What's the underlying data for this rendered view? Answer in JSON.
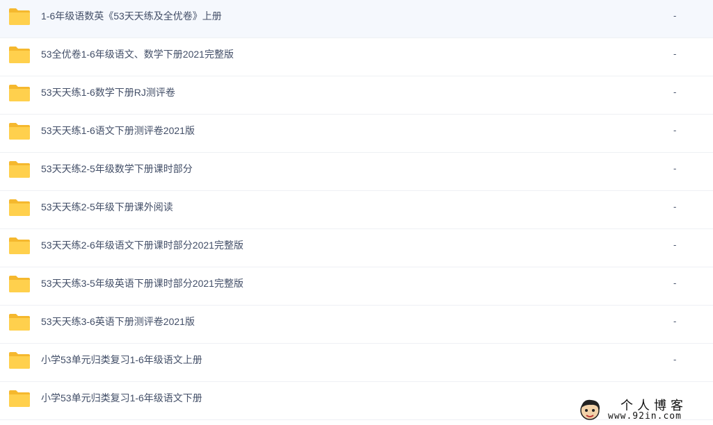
{
  "colors": {
    "folder": "#ffd04d",
    "folder_back": "#f5b82e",
    "text": "#424e67",
    "divider": "#eef0f4"
  },
  "files": [
    {
      "icon": "folder-icon",
      "name": "1-6年级语数英《53天天练及全优卷》上册",
      "size": "-"
    },
    {
      "icon": "folder-icon",
      "name": "53全优卷1-6年级语文、数学下册2021完整版",
      "size": "-"
    },
    {
      "icon": "folder-icon",
      "name": "53天天练1-6数学下册RJ测评卷",
      "size": "-"
    },
    {
      "icon": "folder-icon",
      "name": "53天天练1-6语文下册测评卷2021版",
      "size": "-"
    },
    {
      "icon": "folder-icon",
      "name": "53天天练2-5年级数学下册课时部分",
      "size": "-"
    },
    {
      "icon": "folder-icon",
      "name": "53天天练2-5年级下册课外阅读",
      "size": "-"
    },
    {
      "icon": "folder-icon",
      "name": "53天天练2-6年级语文下册课时部分2021完整版",
      "size": "-"
    },
    {
      "icon": "folder-icon",
      "name": "53天天练3-5年级英语下册课时部分2021完整版",
      "size": "-"
    },
    {
      "icon": "folder-icon",
      "name": "53天天练3-6英语下册测评卷2021版",
      "size": "-"
    },
    {
      "icon": "folder-icon",
      "name": "小学53单元归类复习1-6年级语文上册",
      "size": "-"
    },
    {
      "icon": "folder-icon",
      "name": "小学53单元归类复习1-6年级语文下册",
      "size": ""
    }
  ],
  "watermark": {
    "title": "个人博客",
    "url": "www.92in.com"
  }
}
